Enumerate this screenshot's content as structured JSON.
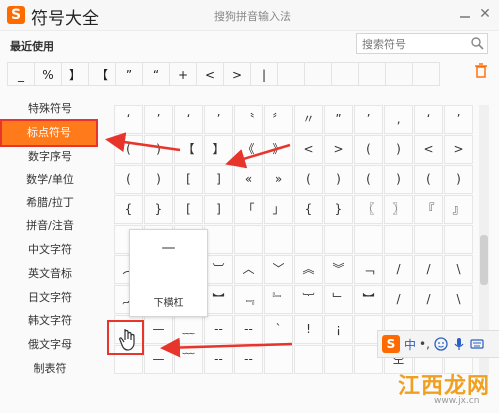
{
  "window": {
    "title": "符号大全",
    "logo_text": "S",
    "subtitle": "搜狗拼音输入法",
    "close_glyph": "✕"
  },
  "recent": {
    "label": "最近使用",
    "symbols": [
      "_",
      "%",
      "】",
      "【",
      "”",
      "“",
      "+",
      "<",
      ">",
      "|",
      "",
      "",
      "",
      "",
      "",
      "",
      ""
    ]
  },
  "search": {
    "placeholder": "搜索符号"
  },
  "sidebar": {
    "items": [
      {
        "label": "特殊符号"
      },
      {
        "label": "标点符号"
      },
      {
        "label": "数字序号"
      },
      {
        "label": "数学/单位"
      },
      {
        "label": "希腊/拉丁"
      },
      {
        "label": "拼音/注音"
      },
      {
        "label": "中文字符"
      },
      {
        "label": "英文音标"
      },
      {
        "label": "日文字符"
      },
      {
        "label": "韩文字符"
      },
      {
        "label": "俄文字母"
      },
      {
        "label": "制表符"
      }
    ],
    "active_index": 1
  },
  "grid": {
    "rows": [
      [
        "‘",
        "’",
        "‘",
        "’",
        "〝",
        "〞",
        "〃",
        "”",
        "’",
        "‚",
        "‘",
        "’"
      ],
      [
        "(",
        ")",
        "【",
        "】",
        "《",
        "》",
        "<",
        ">",
        "(",
        ")",
        "<",
        ">"
      ],
      [
        "(",
        ")",
        "[",
        "]",
        "«",
        "»",
        "(",
        ")",
        "(",
        ")",
        "(",
        ")"
      ],
      [
        "{",
        "}",
        "[",
        "]",
        "「",
        "」",
        "{",
        "}",
        "〖",
        "〗",
        "『",
        "』"
      ],
      [
        "",
        "",
        "",
        "",
        "",
        "",
        "",
        "",
        "",
        "",
        "",
        ""
      ],
      [
        "︵",
        "︶",
        "︹",
        "︺",
        "︿",
        "﹀",
        "︽",
        "︾",
        "﹁",
        "/",
        "/",
        "\\"
      ],
      [
        "︷",
        "︸",
        "︻",
        "︼",
        "﹃",
        "﹄",
        "︸",
        "﹂",
        "︼",
        "/",
        "/",
        "\\"
      ],
      [
        "",
        "—",
        "﹏",
        "--",
        "--",
        "`",
        "!",
        "¡",
        "",
        "",
        "",
        ""
      ],
      [
        "",
        "—",
        "﹋",
        "--",
        "--",
        "",
        "",
        "",
        "",
        "空",
        "",
        ""
      ]
    ]
  },
  "tooltip": {
    "symbol": "—",
    "name": "下横杠"
  },
  "ime": {
    "logo_text": "S",
    "mode_label": "中",
    "punct_label": "•,"
  },
  "watermark": {
    "text": "江西龙网",
    "sub": "www.jx.cn"
  },
  "colors": {
    "accent": "#ff7a1a",
    "highlight_red": "#e8352b",
    "brand": "#ff6a00"
  }
}
